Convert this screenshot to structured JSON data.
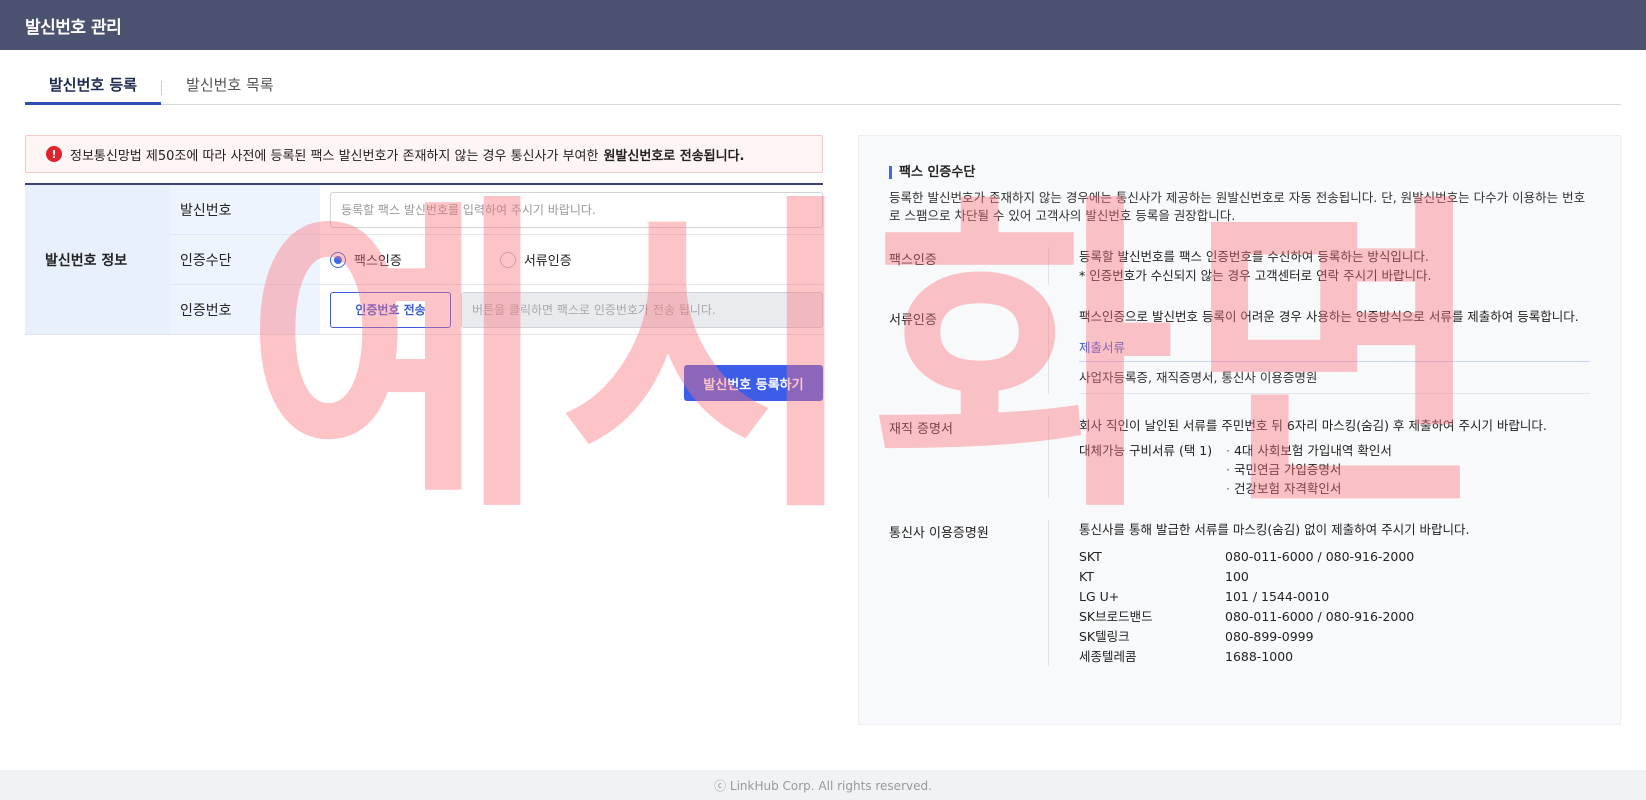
{
  "header": {
    "title": "발신번호 관리"
  },
  "tabs": [
    {
      "label": "발신번호 등록",
      "active": true
    },
    {
      "label": "발신번호 목록",
      "active": false
    }
  ],
  "notice": {
    "icon": "alert-icon",
    "text": "정보통신망법 제50조에 따라 사전에 등록된 팩스 발신번호가 존재하지 않는 경우 통신사가 부여한",
    "emphasis": "원발신번호로 전송됩니다."
  },
  "form": {
    "group_label": "발신번호 정보",
    "sender_number": {
      "label": "발신번호",
      "placeholder": "등록할 팩스 발신번호를 입력하여 주시기 바랍니다."
    },
    "auth_method": {
      "label": "인증수단",
      "options": [
        "팩스인증",
        "서류인증"
      ],
      "selected": "팩스인증"
    },
    "auth_code": {
      "label": "인증번호",
      "send_button": "인증번호 전송",
      "placeholder": "버튼을 클릭하면 팩스로 인증번호가 전송 됩니다."
    },
    "submit_label": "발신번호 등록하기"
  },
  "info": {
    "title": "팩스 인증수단",
    "intro": "등록한 발신번호가 존재하지 않는 경우에는 통신사가 제공하는 원발신번호로 자동 전송됩니다. 단, 원발신번호는 다수가 이용하는 번호로 스팸으로 차단될 수 있어 고객사의 발신번호 등록을 권장합니다.",
    "fax_auth": {
      "title": "팩스인증",
      "line1": "등록할 발신번호를 팩스 인증번호를 수신하여 등록하는 방식입니다.",
      "line2": "* 인증번호가 수신되지 않는 경우 고객센터로 연락 주시기 바랍니다."
    },
    "doc_auth": {
      "title": "서류인증",
      "line1": "팩스인증으로 발신번호 등록이 어려운 경우 사용하는 인증방식으로 서류를 제출하여 등록합니다.",
      "docs_head": "제출서류",
      "docs_list": "사업자등록증, 재직증명서, 통신사 이용증명원"
    },
    "employment": {
      "title": "재직 증명서",
      "line1": "회사 직인이 날인된 서류를 주민번호 뒤 6자리 마스킹(숨김) 후 제출하여 주시기 바랍니다.",
      "alt_label": "대체가능 구비서류 (택 1)",
      "alt_items": [
        "4대 사회보험 가입내역 확인서",
        "국민연금 가입증명서",
        "건강보험 자격확인서"
      ]
    },
    "carrier_cert": {
      "title": "통신사 이용증명원",
      "line1": "통신사를 통해 발급한 서류를 마스킹(숨김) 없이 제출하여 주시기 바랍니다.",
      "carriers": [
        {
          "name": "SKT",
          "phone": "080-011-6000 / 080-916-2000"
        },
        {
          "name": "KT",
          "phone": "100"
        },
        {
          "name": "LG U+",
          "phone": "101 / 1544-0010"
        },
        {
          "name": "SK브로드밴드",
          "phone": "080-011-6000 / 080-916-2000"
        },
        {
          "name": "SK텔링크",
          "phone": "080-899-0999"
        },
        {
          "name": "세종텔레콤",
          "phone": "1688-1000"
        }
      ]
    }
  },
  "footer": {
    "text": "ⓒ LinkHub Corp. All rights reserved."
  },
  "watermark": {
    "text": "예시화면"
  },
  "colors": {
    "header_bg": "#4a5270",
    "accent": "#3b5de7",
    "alert": "#e0242e",
    "watermark": "#fa737d"
  }
}
